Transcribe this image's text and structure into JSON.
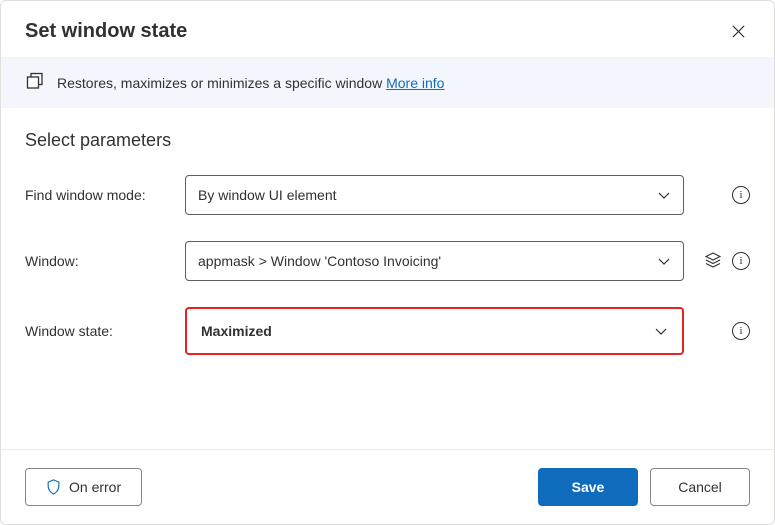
{
  "dialog": {
    "title": "Set window state",
    "close_aria": "Close"
  },
  "info": {
    "icon": "window-copy-icon",
    "description": "Restores, maximizes or minimizes a specific window",
    "more_info": "More info"
  },
  "section": {
    "title": "Select parameters"
  },
  "params": {
    "find_mode": {
      "label": "Find window mode:",
      "value": "By window UI element"
    },
    "window": {
      "label": "Window:",
      "value": "appmask > Window 'Contoso Invoicing'"
    },
    "window_state": {
      "label": "Window state:",
      "value": "Maximized"
    }
  },
  "footer": {
    "on_error": "On error",
    "save": "Save",
    "cancel": "Cancel"
  },
  "colors": {
    "accent": "#0f6cbd",
    "highlight_border": "#e62323",
    "info_bg": "#f3f7fd"
  }
}
